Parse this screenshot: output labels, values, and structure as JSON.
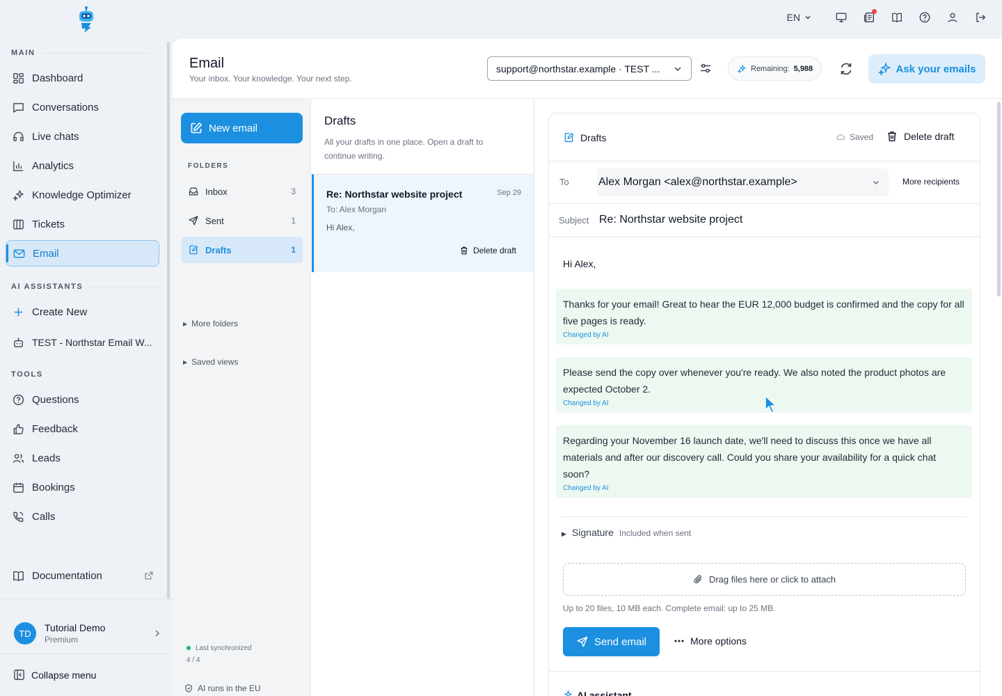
{
  "topbar": {
    "language": "EN",
    "icons": [
      "monitor-icon",
      "news-icon",
      "book-icon",
      "help-icon",
      "user-icon",
      "logout-icon"
    ]
  },
  "sidebar": {
    "section_main": "MAIN",
    "section_ai": "AI ASSISTANTS",
    "section_tools": "TOOLS",
    "items_main": [
      {
        "label": "Dashboard",
        "icon": "dashboard-icon"
      },
      {
        "label": "Conversations",
        "icon": "chat-icon"
      },
      {
        "label": "Live chats",
        "icon": "headset-icon"
      },
      {
        "label": "Analytics",
        "icon": "bar-chart-icon"
      },
      {
        "label": "Knowledge Optimizer",
        "icon": "sparkles-icon"
      },
      {
        "label": "Tickets",
        "icon": "columns-icon"
      },
      {
        "label": "Email",
        "icon": "mail-icon"
      }
    ],
    "items_ai": [
      {
        "label": "Create New",
        "icon": "plus-icon"
      },
      {
        "label": "TEST - Northstar Email W...",
        "icon": "bot-icon"
      }
    ],
    "items_tools": [
      {
        "label": "Questions",
        "icon": "question-icon"
      },
      {
        "label": "Feedback",
        "icon": "thumbs-up-icon"
      },
      {
        "label": "Leads",
        "icon": "users-icon"
      },
      {
        "label": "Bookings",
        "icon": "calendar-icon"
      },
      {
        "label": "Calls",
        "icon": "phone-icon"
      }
    ],
    "documentation": "Documentation",
    "user": {
      "initials": "TD",
      "name": "Tutorial Demo",
      "plan": "Premium"
    },
    "collapse": "Collapse menu"
  },
  "header": {
    "title": "Email",
    "subtitle": "Your inbox. Your knowledge. Your next step.",
    "account": "support@northstar.example · TEST ...",
    "remaining_label": "Remaining:",
    "remaining_value": "5,988",
    "ask_button": "Ask your emails"
  },
  "folders": {
    "new_email": "New email",
    "label": "FOLDERS",
    "items": [
      {
        "label": "Inbox",
        "count": "3"
      },
      {
        "label": "Sent",
        "count": "1"
      },
      {
        "label": "Drafts",
        "count": "1"
      }
    ],
    "more_folders": "More folders",
    "saved_views": "Saved views",
    "sync_label": "Last synchronized",
    "sync_value": "4 / 4",
    "eu_note": "AI runs in the EU"
  },
  "draft_list": {
    "title": "Drafts",
    "description": "All your drafts in one place. Open a draft to continue writing.",
    "card": {
      "subject": "Re: Northstar website project",
      "date": "Sep 29",
      "to": "To: Alex Morgan",
      "preview": "Hi Alex,",
      "delete": "Delete draft"
    }
  },
  "editor": {
    "title": "Drafts",
    "saved": "Saved",
    "delete": "Delete draft",
    "to_label": "To",
    "to_value": "Alex Morgan <alex@northstar.example>",
    "more_recipients": "More recipients",
    "subject_label": "Subject",
    "subject_value": "Re: Northstar website project",
    "greeting": "Hi Alex,",
    "paragraphs": [
      {
        "text": "Thanks for your email! Great to hear the EUR 12,000 budget is confirmed and the copy for all five pages is ready.",
        "tag": "Changed by AI"
      },
      {
        "text": "Please send the copy over whenever you're ready. We also noted the product photos are expected October 2.",
        "tag": "Changed by AI"
      },
      {
        "text": "Regarding your November 16 launch date, we'll need to discuss this once we have all materials and after our discovery call. Could you share your availability for a quick chat soon?",
        "tag": "Changed by AI"
      }
    ],
    "signature": "Signature",
    "signature_note": "Included when sent",
    "attach": "Drag files here or click to attach",
    "limits": "Up to 20 files, 10 MB each. Complete email: up to 25 MB.",
    "send": "Send email",
    "more_options": "More options",
    "ai_assistant": "AI assistant"
  },
  "colors": {
    "accent": "#1c8fe0",
    "accent_light": "#dcedfb",
    "ai_change_bg": "#edf8f1",
    "sidebar_bg": "#eef1f5"
  }
}
